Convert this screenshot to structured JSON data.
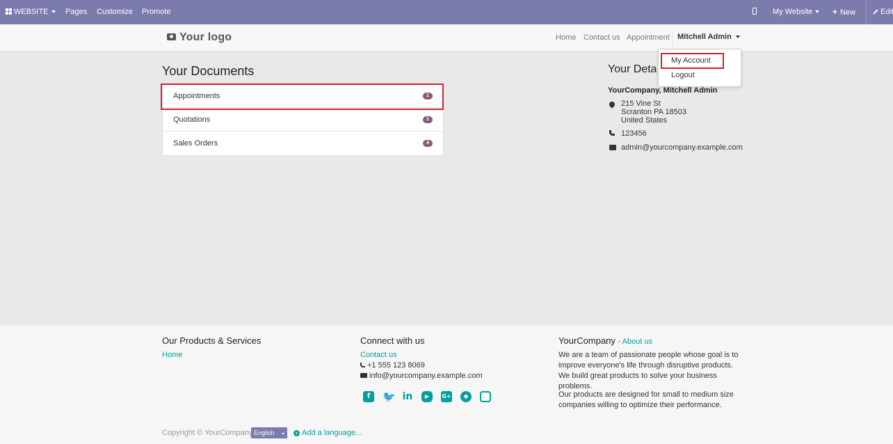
{
  "adminbar": {
    "website_label": "WEBSITE",
    "pages_label": "Pages",
    "customize_label": "Customize",
    "promote_label": "Promote",
    "my_website_label": "My Website",
    "new_label": "New",
    "edit_label": "Edit"
  },
  "navbar": {
    "logo_text": "Your logo",
    "links": [
      "Home",
      "Contact us",
      "Appointment"
    ],
    "user_name": "Mitchell Admin"
  },
  "user_dropdown": {
    "items": [
      "My Account",
      "Logout"
    ]
  },
  "documents": {
    "title": "Your Documents",
    "rows": [
      {
        "label": "Appointments",
        "count": "1"
      },
      {
        "label": "Quotations",
        "count": "1"
      },
      {
        "label": "Sales Orders",
        "count": "4"
      }
    ]
  },
  "details": {
    "title": "Your Details",
    "name": "YourCompany, Mitchell Admin",
    "address_line1": "215 Vine St",
    "address_line2": "Scranton PA 18503",
    "address_line3": "United States",
    "phone": "123456",
    "email": "admin@yourcompany.example.com"
  },
  "footer": {
    "products_heading": "Our Products & Services",
    "products_home_link": "Home",
    "connect_heading": "Connect with us",
    "contact_link": "Contact us",
    "phone": "+1 555 123 8069",
    "email": "info@yourcompany.example.com",
    "company_heading": "YourCompany",
    "about_link": "- About us",
    "about_para1": "We are a team of passionate people whose goal is to improve everyone's life through disruptive products. We build great products to solve your business problems.",
    "about_para2": "Our products are designed for small to medium size companies willing to optimize their performance.",
    "social_icons": [
      "facebook-icon",
      "twitter-icon",
      "linkedin-icon",
      "youtube-icon",
      "google-plus-icon",
      "github-icon",
      "instagram-icon"
    ],
    "copyright": "Copyright © YourCompany",
    "language": "English",
    "add_language": "Add a language..."
  },
  "colors": {
    "adminbar_bg": "#7c7bad",
    "accent_teal": "#00a09d",
    "badge_bg": "#875a7b",
    "highlight_red": "#d32029"
  }
}
